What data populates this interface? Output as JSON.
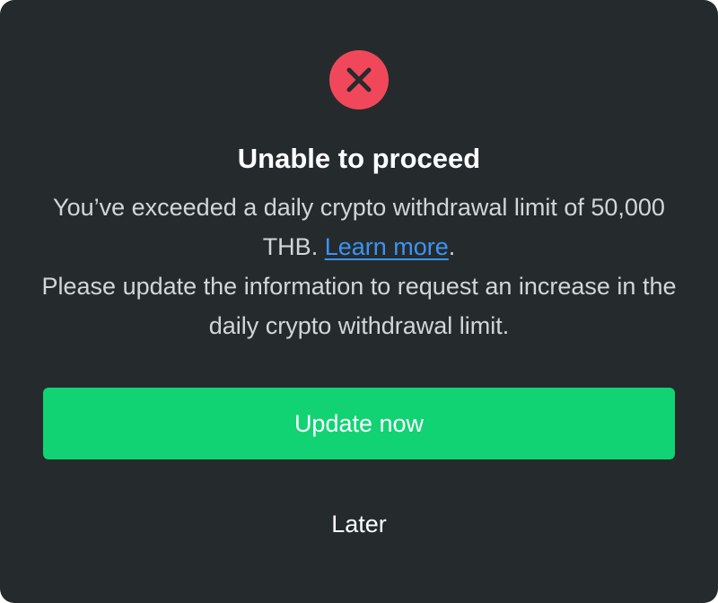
{
  "dialog": {
    "icon": "close-x-icon",
    "title": "Unable to proceed",
    "message_line1_text": "You’ve exceeded a daily crypto withdrawal limit of 50,000 THB.",
    "learn_more_label": "Learn more",
    "message_line1_end": ".",
    "message_line2_text": "Please update the information to request an increase in the daily crypto withdrawal limit.",
    "primary_button_label": "Update now",
    "secondary_button_label": "Later"
  },
  "colors": {
    "background": "#252b2c",
    "error": "#f0485a",
    "primary": "#11d374",
    "link": "#3d93f5",
    "body_text": "#d2d6d6"
  }
}
